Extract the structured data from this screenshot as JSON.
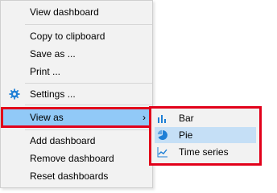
{
  "context_menu": {
    "items": [
      {
        "label": "View dashboard"
      },
      {
        "label": "Copy to clipboard"
      },
      {
        "label": "Save as ..."
      },
      {
        "label": "Print ..."
      },
      {
        "label": "Settings ...",
        "icon": "gear-icon"
      },
      {
        "label": "View as",
        "has_submenu": true,
        "highlighted": true
      },
      {
        "label": "Add dashboard"
      },
      {
        "label": "Remove dashboard"
      },
      {
        "label": "Reset dashboards"
      }
    ],
    "chevron": "›"
  },
  "submenu": {
    "items": [
      {
        "label": "Bar",
        "icon": "bar-chart-icon"
      },
      {
        "label": "Pie",
        "icon": "pie-chart-icon",
        "active": true
      },
      {
        "label": "Time series",
        "icon": "line-chart-icon"
      }
    ]
  },
  "colors": {
    "menu_bg": "#f2f2f2",
    "highlight_bg": "#91c9f7",
    "active_bg": "#c5dff6",
    "annotation_red": "#e2001a",
    "icon_blue": "#1e7fd6"
  }
}
